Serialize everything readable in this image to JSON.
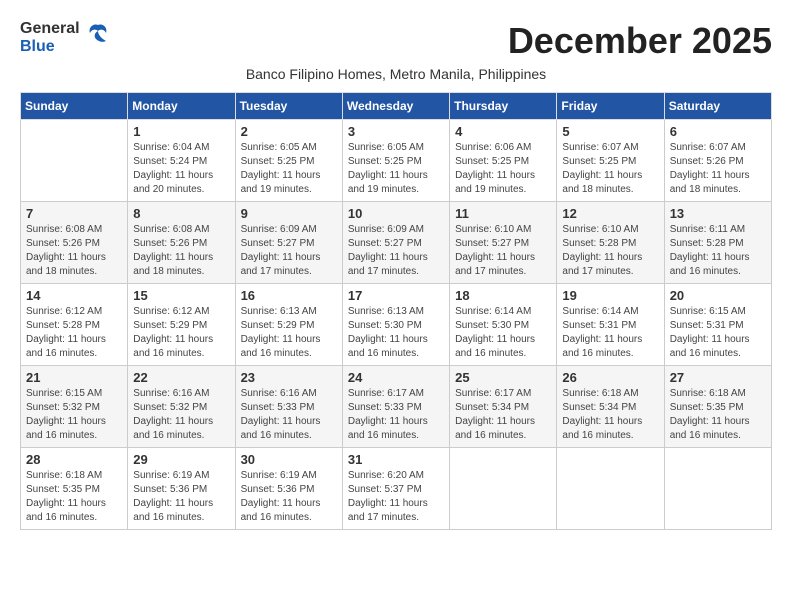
{
  "logo": {
    "general": "General",
    "blue": "Blue"
  },
  "title": "December 2025",
  "subtitle": "Banco Filipino Homes, Metro Manila, Philippines",
  "days_of_week": [
    "Sunday",
    "Monday",
    "Tuesday",
    "Wednesday",
    "Thursday",
    "Friday",
    "Saturday"
  ],
  "weeks": [
    [
      {
        "day": "",
        "info": ""
      },
      {
        "day": "1",
        "info": "Sunrise: 6:04 AM\nSunset: 5:24 PM\nDaylight: 11 hours\nand 20 minutes."
      },
      {
        "day": "2",
        "info": "Sunrise: 6:05 AM\nSunset: 5:25 PM\nDaylight: 11 hours\nand 19 minutes."
      },
      {
        "day": "3",
        "info": "Sunrise: 6:05 AM\nSunset: 5:25 PM\nDaylight: 11 hours\nand 19 minutes."
      },
      {
        "day": "4",
        "info": "Sunrise: 6:06 AM\nSunset: 5:25 PM\nDaylight: 11 hours\nand 19 minutes."
      },
      {
        "day": "5",
        "info": "Sunrise: 6:07 AM\nSunset: 5:25 PM\nDaylight: 11 hours\nand 18 minutes."
      },
      {
        "day": "6",
        "info": "Sunrise: 6:07 AM\nSunset: 5:26 PM\nDaylight: 11 hours\nand 18 minutes."
      }
    ],
    [
      {
        "day": "7",
        "info": "Sunrise: 6:08 AM\nSunset: 5:26 PM\nDaylight: 11 hours\nand 18 minutes."
      },
      {
        "day": "8",
        "info": "Sunrise: 6:08 AM\nSunset: 5:26 PM\nDaylight: 11 hours\nand 18 minutes."
      },
      {
        "day": "9",
        "info": "Sunrise: 6:09 AM\nSunset: 5:27 PM\nDaylight: 11 hours\nand 17 minutes."
      },
      {
        "day": "10",
        "info": "Sunrise: 6:09 AM\nSunset: 5:27 PM\nDaylight: 11 hours\nand 17 minutes."
      },
      {
        "day": "11",
        "info": "Sunrise: 6:10 AM\nSunset: 5:27 PM\nDaylight: 11 hours\nand 17 minutes."
      },
      {
        "day": "12",
        "info": "Sunrise: 6:10 AM\nSunset: 5:28 PM\nDaylight: 11 hours\nand 17 minutes."
      },
      {
        "day": "13",
        "info": "Sunrise: 6:11 AM\nSunset: 5:28 PM\nDaylight: 11 hours\nand 16 minutes."
      }
    ],
    [
      {
        "day": "14",
        "info": "Sunrise: 6:12 AM\nSunset: 5:28 PM\nDaylight: 11 hours\nand 16 minutes."
      },
      {
        "day": "15",
        "info": "Sunrise: 6:12 AM\nSunset: 5:29 PM\nDaylight: 11 hours\nand 16 minutes."
      },
      {
        "day": "16",
        "info": "Sunrise: 6:13 AM\nSunset: 5:29 PM\nDaylight: 11 hours\nand 16 minutes."
      },
      {
        "day": "17",
        "info": "Sunrise: 6:13 AM\nSunset: 5:30 PM\nDaylight: 11 hours\nand 16 minutes."
      },
      {
        "day": "18",
        "info": "Sunrise: 6:14 AM\nSunset: 5:30 PM\nDaylight: 11 hours\nand 16 minutes."
      },
      {
        "day": "19",
        "info": "Sunrise: 6:14 AM\nSunset: 5:31 PM\nDaylight: 11 hours\nand 16 minutes."
      },
      {
        "day": "20",
        "info": "Sunrise: 6:15 AM\nSunset: 5:31 PM\nDaylight: 11 hours\nand 16 minutes."
      }
    ],
    [
      {
        "day": "21",
        "info": "Sunrise: 6:15 AM\nSunset: 5:32 PM\nDaylight: 11 hours\nand 16 minutes."
      },
      {
        "day": "22",
        "info": "Sunrise: 6:16 AM\nSunset: 5:32 PM\nDaylight: 11 hours\nand 16 minutes."
      },
      {
        "day": "23",
        "info": "Sunrise: 6:16 AM\nSunset: 5:33 PM\nDaylight: 11 hours\nand 16 minutes."
      },
      {
        "day": "24",
        "info": "Sunrise: 6:17 AM\nSunset: 5:33 PM\nDaylight: 11 hours\nand 16 minutes."
      },
      {
        "day": "25",
        "info": "Sunrise: 6:17 AM\nSunset: 5:34 PM\nDaylight: 11 hours\nand 16 minutes."
      },
      {
        "day": "26",
        "info": "Sunrise: 6:18 AM\nSunset: 5:34 PM\nDaylight: 11 hours\nand 16 minutes."
      },
      {
        "day": "27",
        "info": "Sunrise: 6:18 AM\nSunset: 5:35 PM\nDaylight: 11 hours\nand 16 minutes."
      }
    ],
    [
      {
        "day": "28",
        "info": "Sunrise: 6:18 AM\nSunset: 5:35 PM\nDaylight: 11 hours\nand 16 minutes."
      },
      {
        "day": "29",
        "info": "Sunrise: 6:19 AM\nSunset: 5:36 PM\nDaylight: 11 hours\nand 16 minutes."
      },
      {
        "day": "30",
        "info": "Sunrise: 6:19 AM\nSunset: 5:36 PM\nDaylight: 11 hours\nand 16 minutes."
      },
      {
        "day": "31",
        "info": "Sunrise: 6:20 AM\nSunset: 5:37 PM\nDaylight: 11 hours\nand 17 minutes."
      },
      {
        "day": "",
        "info": ""
      },
      {
        "day": "",
        "info": ""
      },
      {
        "day": "",
        "info": ""
      }
    ]
  ]
}
